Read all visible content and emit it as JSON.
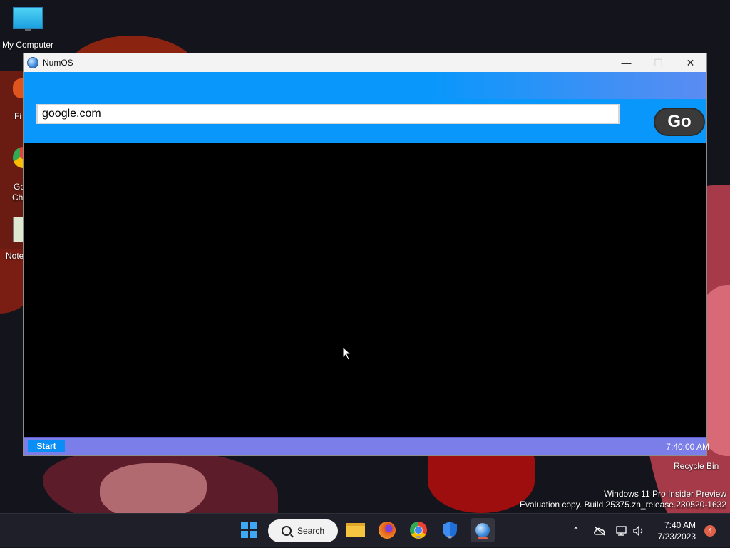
{
  "desktop": {
    "icons": [
      {
        "label": "My Computer"
      },
      {
        "label": "Fi"
      },
      {
        "label": "Go"
      },
      {
        "label": "Ch"
      },
      {
        "label": "Note"
      }
    ],
    "recycle_bin": "Recycle Bin",
    "watermark": {
      "line1": "Windows 11 Pro Insider Preview",
      "line2": "Evaluation copy. Build 25375.zn_release.230520-1632"
    }
  },
  "window": {
    "title": "NumOS",
    "controls": {
      "minimize": "—",
      "maximize": "☐",
      "close": "✕"
    },
    "url_value": "google.com",
    "go_label": "Go",
    "taskbar": {
      "start_label": "Start",
      "clock": "7:40:00 AM"
    }
  },
  "taskbar": {
    "search_label": "Search",
    "time": "7:40 AM",
    "date": "7/23/2023",
    "notification_count": "4",
    "pinned": [
      "file-explorer-icon",
      "firefox-icon",
      "chrome-icon",
      "defender-icon",
      "numos-icon"
    ]
  },
  "colors": {
    "browser_blue": "#0a97fb",
    "inner_taskbar": "#7b7de8",
    "go_button": "#3a3a3a"
  }
}
